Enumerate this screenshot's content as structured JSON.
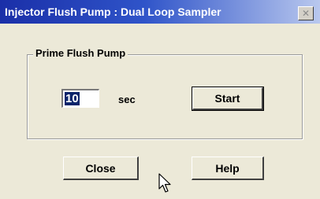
{
  "window": {
    "title": "Injector Flush Pump : Dual Loop Sampler",
    "close_glyph": "✕"
  },
  "prime_group": {
    "legend": "Prime Flush Pump",
    "seconds_value": "10",
    "unit_label": "sec",
    "start_label": "Start"
  },
  "footer": {
    "close_label": "Close",
    "help_label": "Help"
  },
  "colors": {
    "titlebar_start": "#1a2fa8",
    "titlebar_end": "#b9c8ee",
    "dialog_background": "#ece9d8",
    "selection": "#0a246a"
  },
  "icons": {
    "close": "close-icon",
    "cursor": "mouse-pointer-icon"
  }
}
